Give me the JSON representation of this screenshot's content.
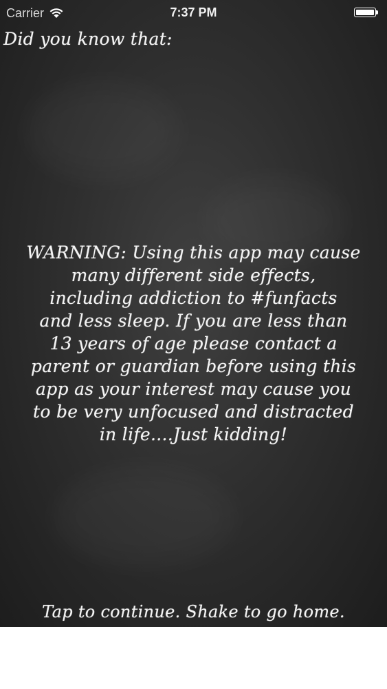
{
  "status_bar": {
    "carrier": "Carrier",
    "time": "7:37 PM",
    "wifi_icon": "wifi-icon",
    "battery_icon": "battery-full-icon",
    "battery_level": 1.0
  },
  "main": {
    "heading": "Did you know that:",
    "fact_text": "WARNING: Using this app may cause\nmany different side effects,\nincluding addiction to #funfacts\nand less sleep. If you are less than\n13 years of age please contact a\nparent or guardian before using this\napp as your interest may cause you\nto be very unfocused and distracted\nin life....Just kidding!",
    "continue_hint": "Tap to continue. Shake to go home."
  },
  "colors": {
    "chalkboard": "#2f2f2f",
    "chalk": "#f4f4f4",
    "below_screen": "#ffffff"
  }
}
